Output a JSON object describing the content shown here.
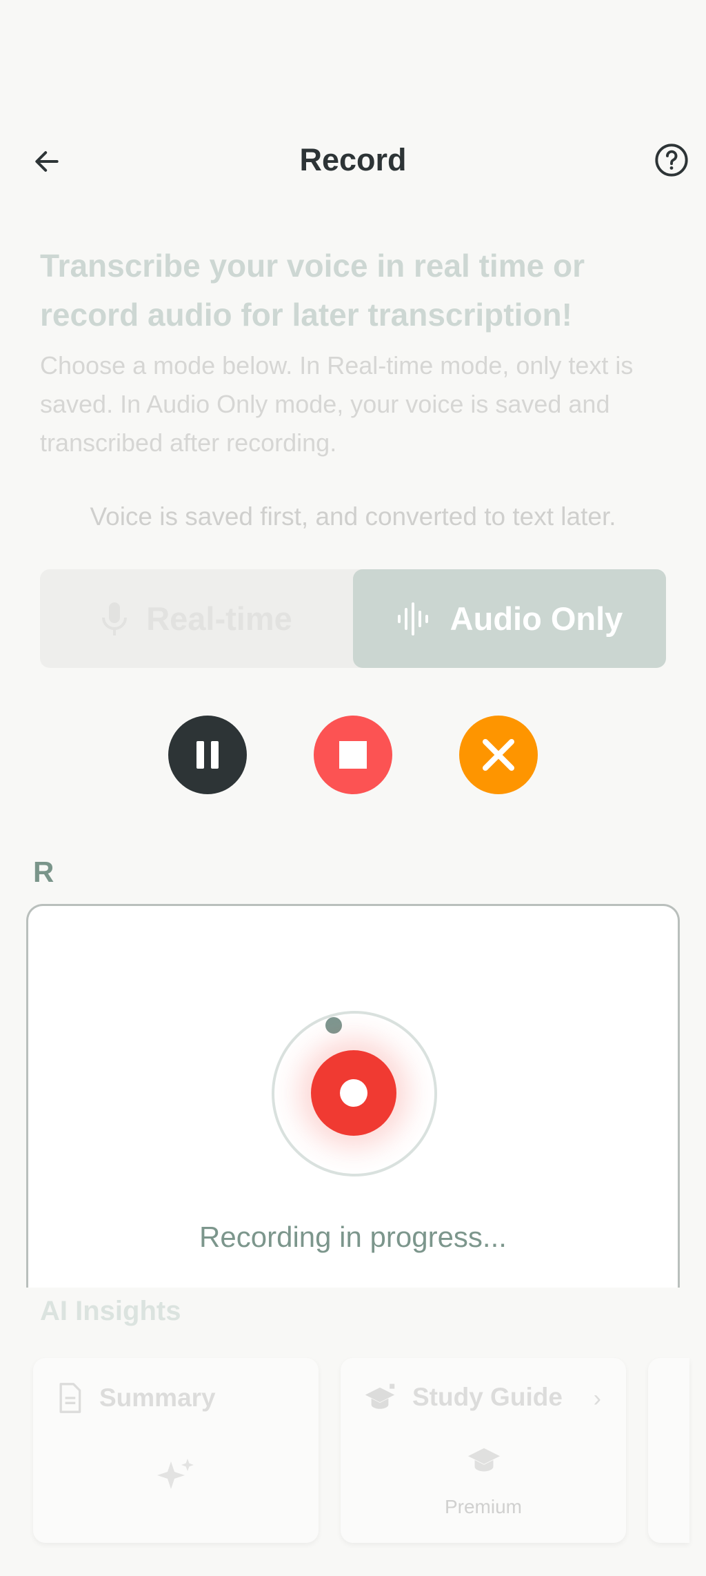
{
  "header": {
    "title": "Record",
    "back_icon": "arrow-left-icon",
    "help_icon": "help-circle-icon"
  },
  "intro": {
    "headline": "Transcribe your voice in real time or record audio for later transcription!",
    "description": "Choose a mode below. In Real-time mode, only text is saved. In Audio Only mode, your voice is saved and transcribed after recording."
  },
  "mode_hint": "Voice is saved first, and converted to text later.",
  "mode_toggle": {
    "options": [
      {
        "label": "Real-time",
        "icon": "microphone-icon",
        "selected": false
      },
      {
        "label": "Audio Only",
        "icon": "audio-wave-icon",
        "selected": true
      }
    ]
  },
  "controls": {
    "pause": {
      "icon": "pause-icon",
      "color": "#2d3436"
    },
    "stop": {
      "icon": "stop-icon",
      "color": "#fc5353"
    },
    "cancel": {
      "icon": "close-icon",
      "color": "#fe9500"
    }
  },
  "section_letter": "R",
  "recording": {
    "status": "Recording in progress...",
    "accent": "#f03a32"
  },
  "insights": {
    "title": "AI Insights",
    "cards": [
      {
        "label": "Summary",
        "icon": "document-icon",
        "body_icon": "sparkle-icon"
      },
      {
        "label": "Study Guide",
        "icon": "graduation-cap-icon",
        "body_icon": "graduation-cap-icon",
        "badge": "Premium"
      }
    ]
  }
}
